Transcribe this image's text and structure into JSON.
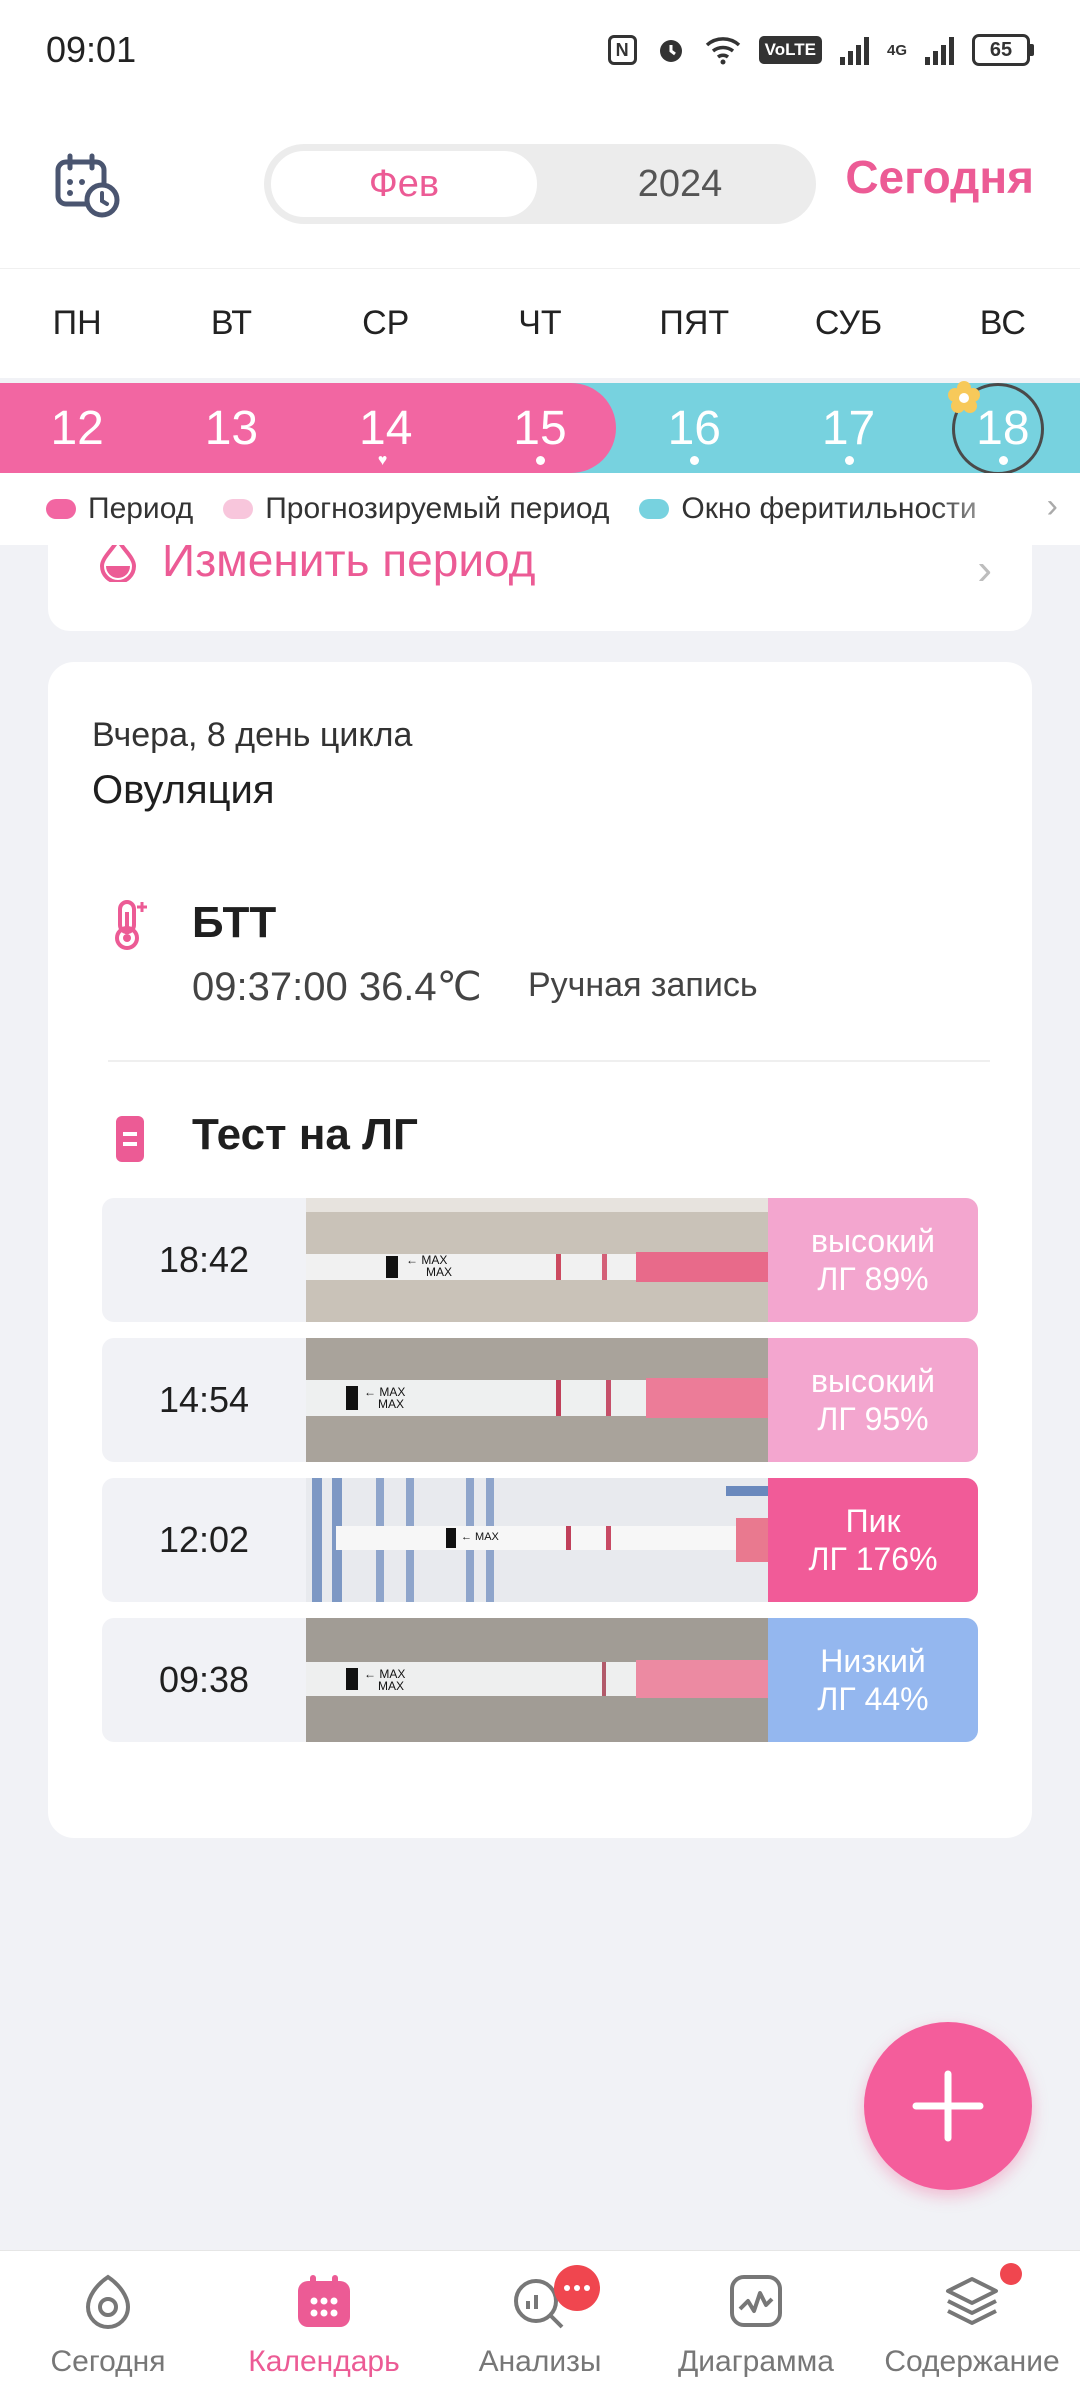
{
  "status_bar": {
    "time": "09:01",
    "volte": "VoLTE",
    "network": "4G",
    "battery": "65"
  },
  "header": {
    "month": "Фев",
    "year": "2024",
    "today_button": "Сегодня"
  },
  "weekdays": [
    "ПН",
    "ВТ",
    "СР",
    "ЧТ",
    "ПЯТ",
    "СУБ",
    "ВС"
  ],
  "days": [
    "12",
    "13",
    "14",
    "15",
    "16",
    "17",
    "18"
  ],
  "legend": {
    "period": "Период",
    "predicted": "Прогнозируемый период",
    "fertile": "Окно феритильности"
  },
  "colors": {
    "accent": "#ec5b95",
    "period": "#f266a2",
    "predicted": "#f8c6dc",
    "fertile": "#77d2df",
    "badge_high": "#f3a6cf",
    "badge_peak": "#f15b98",
    "badge_low": "#94b7ef"
  },
  "change_period": "Изменить период",
  "record": {
    "day_info": "Вчера, 8 день цикла",
    "phase": "Овуляция",
    "bbt": {
      "title": "БТТ",
      "value": "09:37:00 36.4℃",
      "note": "Ручная запись"
    },
    "lh": {
      "title": "Тест на ЛГ",
      "tests": [
        {
          "time": "18:42",
          "level": "высокий",
          "value": "ЛГ 89%"
        },
        {
          "time": "14:54",
          "level": "высокий",
          "value": "ЛГ 95%"
        },
        {
          "time": "12:02",
          "level": "Пик",
          "value": "ЛГ 176%"
        },
        {
          "time": "09:38",
          "level": "Низкий",
          "value": "ЛГ 44%"
        }
      ]
    }
  },
  "bottom_nav": [
    {
      "label": "Сегодня",
      "icon": "today-icon"
    },
    {
      "label": "Календарь",
      "icon": "calendar-icon"
    },
    {
      "label": "Анализы",
      "icon": "analysis-icon"
    },
    {
      "label": "Диаграмма",
      "icon": "chart-icon"
    },
    {
      "label": "Содержание",
      "icon": "layers-icon"
    }
  ]
}
